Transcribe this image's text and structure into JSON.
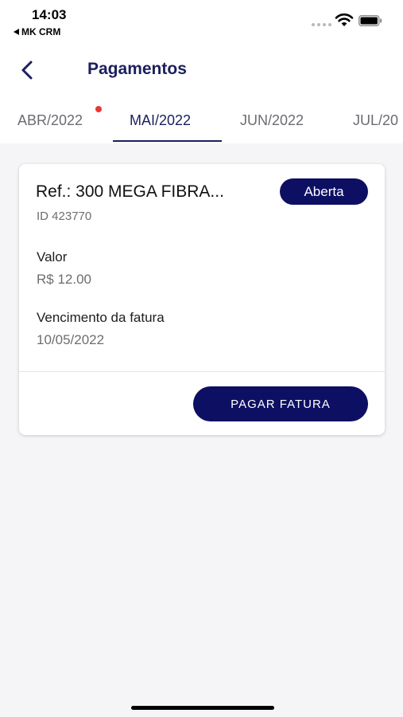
{
  "status_bar": {
    "time": "14:03",
    "back_app": "MK CRM",
    "wifi_icon": "wifi-icon",
    "battery_icon": "battery-icon"
  },
  "header": {
    "title": "Pagamentos",
    "back_icon": "chevron-left-icon"
  },
  "tabs": [
    {
      "label": "ABR/2022",
      "active": false,
      "has_notification": true
    },
    {
      "label": "MAI/2022",
      "active": true,
      "has_notification": false
    },
    {
      "label": "JUN/2022",
      "active": false,
      "has_notification": false
    },
    {
      "label": "JUL/20",
      "active": false,
      "has_notification": false
    }
  ],
  "invoice": {
    "reference": "Ref.: 300 MEGA FIBRA...",
    "status": "Aberta",
    "id": "ID 423770",
    "value_label": "Valor",
    "value": "R$ 12.00",
    "due_label": "Vencimento da fatura",
    "due_date": "10/05/2022",
    "pay_button": "PAGAR FATURA"
  },
  "colors": {
    "primary": "#0d0f63",
    "title": "#1b1f5e",
    "notification_dot": "#e53935",
    "background": "#f5f5f7"
  }
}
